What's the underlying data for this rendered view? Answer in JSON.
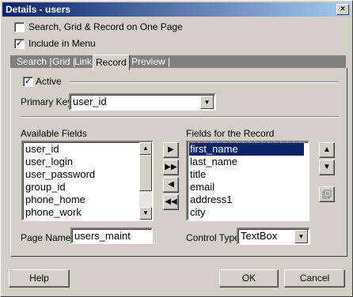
{
  "window": {
    "title": "Details - users",
    "close_glyph": "×"
  },
  "options": {
    "search_grid_record_label": "Search, Grid & Record on One Page",
    "search_grid_record_checked": false,
    "include_in_menu_label": "Include in Menu",
    "include_in_menu_checked": true
  },
  "tabs": [
    {
      "label": "Search |",
      "active": false
    },
    {
      "label": "Grid |",
      "active": false
    },
    {
      "label": "Link |",
      "active": false
    },
    {
      "label": "Record",
      "active": true
    },
    {
      "label": "Preview |",
      "active": false
    }
  ],
  "record": {
    "active_label": "Active",
    "active_checked": true,
    "primary_key_label": "Primary Key",
    "primary_key_value": "user_id",
    "available_fields_label": "Available Fields",
    "available_fields": [
      "user_id",
      "user_login",
      "user_password",
      "group_id",
      "phone_home",
      "phone_work"
    ],
    "record_fields_label": "Fields for the Record",
    "record_fields": [
      "first_name",
      "last_name",
      "title",
      "email",
      "address1",
      "city"
    ],
    "record_fields_selected": "first_name",
    "page_name_label": "Page Name",
    "page_name_value": "users_maint",
    "control_type_label": "Control Type",
    "control_type_value": "TextBox"
  },
  "buttons": {
    "help": "Help",
    "ok": "OK",
    "cancel": "Cancel"
  },
  "glyphs": {
    "check": "✓",
    "dropdown": "▼",
    "scroll_up": "▲",
    "scroll_down": "▼",
    "move_one": "▶",
    "move_all": "▶▶",
    "remove_one": "◀",
    "remove_all": "◀◀",
    "up": "▲",
    "down": "▼"
  }
}
